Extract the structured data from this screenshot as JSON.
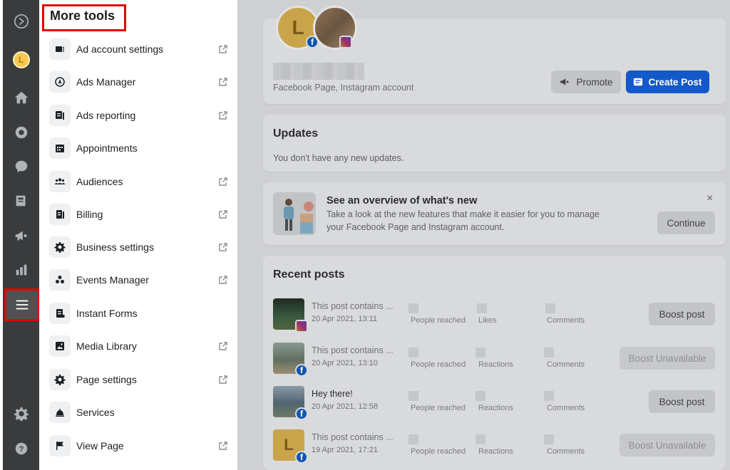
{
  "rail": {
    "avatar_letter": "L",
    "icons": [
      "meta-logo-icon",
      "avatar",
      "home-icon",
      "inbox-icon",
      "chat-icon",
      "content-icon",
      "megaphone-icon",
      "insights-icon",
      "menu-icon",
      "gear-icon",
      "help-icon"
    ]
  },
  "tools": {
    "title": "More tools",
    "items": [
      {
        "label": "Ad account settings",
        "icon": "ad-account-icon",
        "external": true
      },
      {
        "label": "Ads Manager",
        "icon": "ads-manager-icon",
        "external": true
      },
      {
        "label": "Ads reporting",
        "icon": "ads-reporting-icon",
        "external": true
      },
      {
        "label": "Appointments",
        "icon": "calendar-icon",
        "external": false
      },
      {
        "label": "Audiences",
        "icon": "audiences-icon",
        "external": true
      },
      {
        "label": "Billing",
        "icon": "billing-icon",
        "external": true
      },
      {
        "label": "Business settings",
        "icon": "gear-icon",
        "external": true
      },
      {
        "label": "Events Manager",
        "icon": "events-icon",
        "external": true
      },
      {
        "label": "Instant Forms",
        "icon": "form-icon",
        "external": false
      },
      {
        "label": "Media Library",
        "icon": "media-icon",
        "external": true
      },
      {
        "label": "Page settings",
        "icon": "gear-icon",
        "external": true
      },
      {
        "label": "Services",
        "icon": "bell-icon",
        "external": false
      },
      {
        "label": "View Page",
        "icon": "flag-icon",
        "external": true
      }
    ]
  },
  "profile": {
    "letter": "L",
    "subtitle": "Facebook Page, Instagram account",
    "promote_label": "Promote",
    "create_post_label": "Create Post"
  },
  "updates": {
    "title": "Updates",
    "text": "You don't have any new updates."
  },
  "whatsnew": {
    "title": "See an overview of what's new",
    "text_line1": "Take a look at the new features that make it easier for you to manage",
    "text_line2": "your Facebook Page and Instagram account.",
    "continue_label": "Continue",
    "close_label": "×"
  },
  "recent_posts": {
    "title": "Recent posts",
    "posts": [
      {
        "title": "This post contains ...",
        "date": "20 Apr 2021, 13:11",
        "m1": "People reached",
        "m2": "Likes",
        "m3": "Comments",
        "action": "Boost post",
        "available": true,
        "platform": "instagram"
      },
      {
        "title": "This post contains ...",
        "date": "20 Apr 2021, 13:10",
        "m1": "People reached",
        "m2": "Reactions",
        "m3": "Comments",
        "action": "Boost Unavailable",
        "available": false,
        "platform": "facebook"
      },
      {
        "title": "Hey there!",
        "date": "20 Apr 2021, 12:58",
        "m1": "People reached",
        "m2": "Reactions",
        "m3": "Comments",
        "action": "Boost post",
        "available": true,
        "platform": "facebook"
      },
      {
        "title": "This post contains ...",
        "date": "19 Apr 2021, 17:21",
        "m1": "People reached",
        "m2": "Reactions",
        "m3": "Comments",
        "action": "Boost Unavailable",
        "available": false,
        "platform": "facebook"
      }
    ]
  },
  "colors": {
    "accent_blue": "#1459c9",
    "highlight_red": "#e10600",
    "rail_bg": "#3a3b3c"
  }
}
